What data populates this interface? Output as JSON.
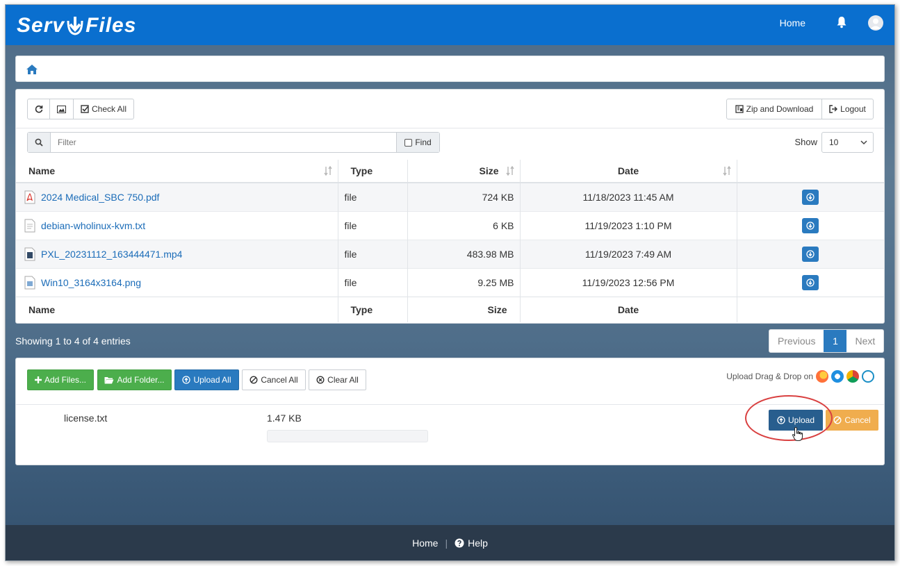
{
  "brand": {
    "logo_left": "Serv",
    "logo_right": "Files"
  },
  "topnav": {
    "home": "Home",
    "bell_icon": "bell-icon",
    "user_icon": "user-avatar-icon"
  },
  "breadcrumb": {
    "home_icon": "home-icon"
  },
  "toolbar": {
    "refresh_icon": "refresh-icon",
    "image_icon": "image-icon",
    "check_all": "Check All",
    "zip_download": "Zip and Download",
    "logout": "Logout"
  },
  "filter": {
    "placeholder": "Filter",
    "find": "Find",
    "show_label": "Show",
    "show_value": "10"
  },
  "table": {
    "headers": {
      "name": "Name",
      "type": "Type",
      "size": "Size",
      "date": "Date"
    },
    "rows": [
      {
        "name": "2024 Medical_SBC 750.pdf",
        "type": "file",
        "size": "724 KB",
        "date": "11/18/2023 11:45 AM",
        "icon": "pdf-file-icon"
      },
      {
        "name": "debian-wholinux-kvm.txt",
        "type": "file",
        "size": "6 KB",
        "date": "11/19/2023 1:10 PM",
        "icon": "text-file-icon"
      },
      {
        "name": "PXL_20231112_163444471.mp4",
        "type": "file",
        "size": "483.98 MB",
        "date": "11/19/2023 7:49 AM",
        "icon": "video-file-icon"
      },
      {
        "name": "Win10_3164x3164.png",
        "type": "file",
        "size": "9.25 MB",
        "date": "11/19/2023 12:56 PM",
        "icon": "image-file-icon"
      }
    ]
  },
  "pagination": {
    "showing": "Showing 1 to 4 of 4 entries",
    "previous": "Previous",
    "page": "1",
    "next": "Next"
  },
  "upload": {
    "add_files": "Add Files...",
    "add_folder": "Add Folder...",
    "upload_all": "Upload All",
    "cancel_all": "Cancel All",
    "clear_all": "Clear All",
    "dnd_text": "Upload Drag & Drop on",
    "queue": [
      {
        "name": "license.txt",
        "size": "1.47 KB",
        "progress": 0,
        "upload": "Upload",
        "cancel": "Cancel"
      }
    ]
  },
  "footer": {
    "home": "Home",
    "separator": "|",
    "help": "Help"
  },
  "colors": {
    "topbar": "#0a6fcf",
    "primary": "#2a7abf",
    "success": "#4cae4c",
    "warning": "#f0ad4e",
    "footer": "#2b3a4b",
    "highlight": "#d94040"
  }
}
